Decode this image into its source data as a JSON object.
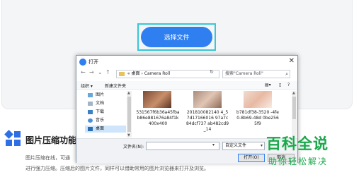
{
  "page": {
    "select_button": "选择文件",
    "feature_title": "图片压缩功能",
    "feature_desc_1": "图片压缩在线，可通",
    "feature_desc_2": "进行强力压缩。压缩后的图片文件，同样可以借助常用的图片浏览器来打开及浏览。"
  },
  "dialog": {
    "title": "打开",
    "close": "✕",
    "nav": {
      "back": "←",
      "forward": "→",
      "recent": "⌄",
      "up": "↑"
    },
    "address": {
      "sep1": "«",
      "part1": "桌面",
      "sep2": "›",
      "part2": "Camera Roll"
    },
    "refresh": "↻",
    "search_placeholder": "搜索\"Camera Roll\"",
    "search_icon": "search-icon",
    "toolbar": {
      "organize": "组织 ▾",
      "new_folder": "新建文件夹"
    },
    "sidebar": [
      {
        "label": "图片",
        "icon": "pictures-icon"
      },
      {
        "label": "文档",
        "icon": "documents-icon"
      },
      {
        "label": "下载",
        "icon": "downloads-icon"
      },
      {
        "label": "音乐",
        "icon": "music-icon"
      },
      {
        "label": "桌面",
        "icon": "desktop-icon",
        "selected": true
      }
    ],
    "files": [
      {
        "name": "531567f6b36a45fbab86e881676a84f1k400x400"
      },
      {
        "name": "201810082140 4_57d17166016 97a7c84dcf737 ab482cd9_14"
      },
      {
        "name": "b781df38-3520 -4fe0-8b69-48d 0be2565f9"
      }
    ],
    "file_name_label": "文件名(N):",
    "file_name_value": "",
    "filter": "自定义文件",
    "open_button": "打开(O)",
    "cancel_button": "取消"
  },
  "watermark": {
    "main": "百科全说",
    "sub": "助你轻松解决"
  },
  "colors": {
    "accent": "#2f7ff0",
    "highlight": "#36c8d6",
    "watermark": "#1aa84b"
  }
}
